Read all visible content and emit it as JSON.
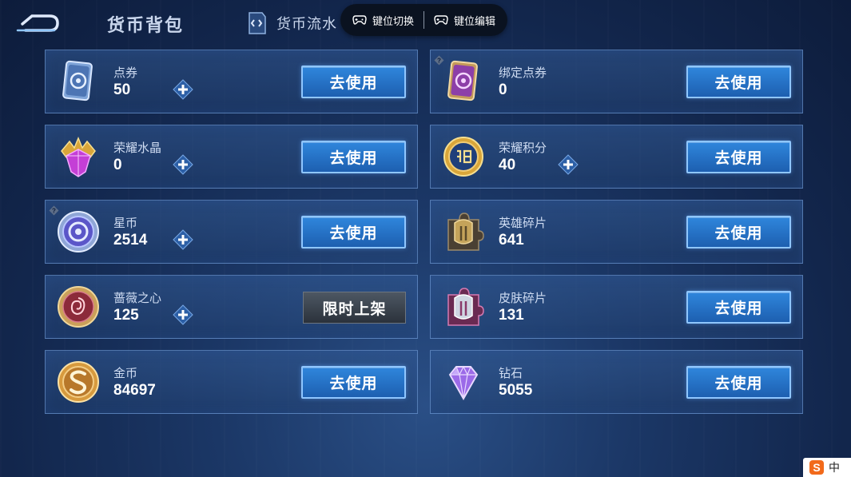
{
  "header": {
    "title": "货币背包",
    "tab_flow": "货币流水"
  },
  "keymap": {
    "switch_label": "键位切换",
    "edit_label": "键位编辑"
  },
  "currencies": [
    {
      "name": "点券",
      "amount": "50",
      "icon": "coupon-card-icon",
      "action": "去使用"
    },
    {
      "name": "绑定点券",
      "amount": "0",
      "icon": "bound-coupon-card-icon",
      "action": "去使用"
    },
    {
      "name": "荣耀水晶",
      "amount": "0",
      "icon": "glory-crystal-icon",
      "action": "去使用"
    },
    {
      "name": "荣耀积分",
      "amount": "40",
      "icon": "glory-points-icon",
      "action": "去使用"
    },
    {
      "name": "星币",
      "amount": "2514",
      "icon": "star-coin-icon",
      "action": "去使用"
    },
    {
      "name": "英雄碎片",
      "amount": "641",
      "icon": "hero-fragment-icon",
      "action": "去使用"
    },
    {
      "name": "蔷薇之心",
      "amount": "125",
      "icon": "rose-heart-icon",
      "action": "限时上架"
    },
    {
      "name": "皮肤碎片",
      "amount": "131",
      "icon": "skin-fragment-icon",
      "action": "去使用"
    },
    {
      "name": "金币",
      "amount": "84697",
      "icon": "gold-coin-icon",
      "action": "去使用"
    },
    {
      "name": "钻石",
      "amount": "5055",
      "icon": "diamond-icon",
      "action": "去使用"
    }
  ],
  "corner_app": {
    "logo": "S",
    "text": "中"
  },
  "colors": {
    "button_blue": "#2f86dc",
    "button_border": "#8fc6ff",
    "background": "#1b3766"
  }
}
